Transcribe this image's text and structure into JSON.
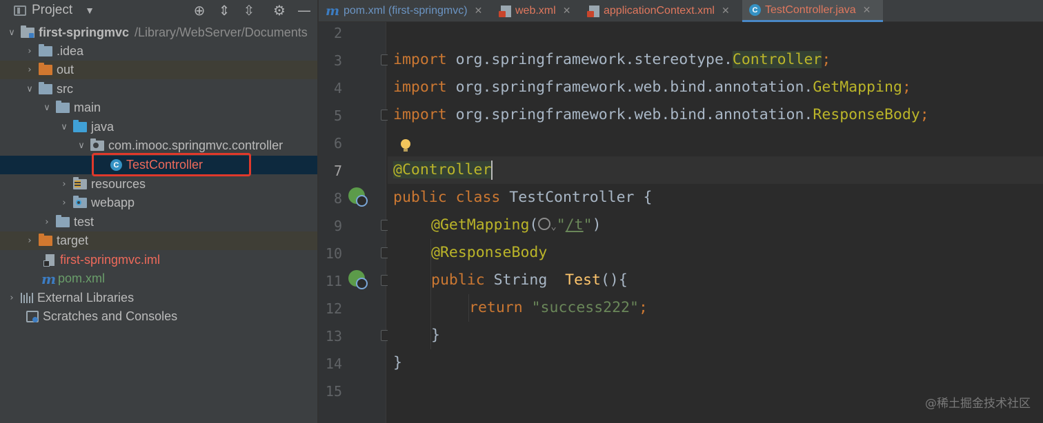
{
  "project_panel": {
    "title": "Project",
    "toolbar_icons": [
      "locate-icon",
      "expand-all-icon",
      "collapse-all-icon",
      "gear-icon",
      "minimize-icon"
    ],
    "tree": [
      {
        "label": "first-springmvc",
        "path": "/Library/WebServer/Documents",
        "depth": 0,
        "expanded": true,
        "icon": "module-folder-icon"
      },
      {
        "label": ".idea",
        "depth": 1,
        "expanded": false,
        "icon": "folder-icon"
      },
      {
        "label": "out",
        "depth": 1,
        "expanded": false,
        "icon": "excluded-folder-icon"
      },
      {
        "label": "src",
        "depth": 1,
        "expanded": true,
        "icon": "folder-icon"
      },
      {
        "label": "main",
        "depth": 2,
        "expanded": true,
        "icon": "folder-icon"
      },
      {
        "label": "java",
        "depth": 3,
        "expanded": true,
        "icon": "source-folder-icon"
      },
      {
        "label": "com.imooc.springmvc.controller",
        "depth": 4,
        "expanded": true,
        "icon": "package-icon"
      },
      {
        "label": "TestController",
        "depth": 5,
        "icon": "java-class-icon",
        "selected": true
      },
      {
        "label": "resources",
        "depth": 3,
        "expanded": false,
        "icon": "resources-folder-icon"
      },
      {
        "label": "webapp",
        "depth": 3,
        "expanded": false,
        "icon": "web-folder-icon"
      },
      {
        "label": "test",
        "depth": 2,
        "expanded": false,
        "icon": "folder-icon"
      },
      {
        "label": "target",
        "depth": 1,
        "expanded": false,
        "icon": "excluded-folder-icon"
      },
      {
        "label": "first-springmvc.iml",
        "depth": 1,
        "icon": "iml-file-icon"
      },
      {
        "label": "pom.xml",
        "depth": 1,
        "icon": "maven-icon"
      },
      {
        "label": "External Libraries",
        "depth": 0,
        "expanded": false,
        "icon": "libraries-icon"
      },
      {
        "label": "Scratches and Consoles",
        "depth": 0,
        "icon": "scratches-icon"
      }
    ]
  },
  "tabs": [
    {
      "label": "pom.xml (first-springmvc)",
      "icon": "maven-icon"
    },
    {
      "label": "web.xml",
      "icon": "xml-file-icon"
    },
    {
      "label": "applicationContext.xml",
      "icon": "xml-file-icon"
    },
    {
      "label": "TestController.java",
      "icon": "java-class-icon",
      "active": true
    }
  ],
  "editor": {
    "line_numbers": [
      "2",
      "3",
      "4",
      "5",
      "6",
      "7",
      "8",
      "9",
      "10",
      "11",
      "12",
      "13",
      "14",
      "15"
    ],
    "current_line": "7",
    "code": {
      "l3_kw": "import",
      "l3_pkg": " org.springframework.stereotype.",
      "l3_cls": "Controller",
      "l3_end": ";",
      "l4_kw": "import",
      "l4_pkg": " org.springframework.web.bind.annotation.",
      "l4_cls": "GetMapping",
      "l4_end": ";",
      "l5_kw": "import",
      "l5_pkg": " org.springframework.web.bind.annotation.",
      "l5_cls": "ResponseBody",
      "l5_end": ";",
      "l7_ann": "@Controller",
      "l8_kw": "public class",
      "l8_rest": " TestController {",
      "l9_ann": "@GetMapping",
      "l9_open": "(",
      "l9_quote1": "\"",
      "l9_url": "/t",
      "l9_quote2": "\"",
      "l9_close": ")",
      "l10_ann": "@ResponseBody",
      "l11_kw": "public",
      "l11_type": " String  ",
      "l11_method": "Test",
      "l11_rest": "(){",
      "l12_kw": "return",
      "l12_str": " \"success222\"",
      "l12_end": ";",
      "l13": "}",
      "l14": "}"
    }
  },
  "watermark": "@稀土掘金技术社区",
  "colors": {
    "keyword": "#cc7832",
    "annotation": "#bbb529",
    "string": "#6a8759",
    "method": "#ffc66d",
    "highlight_border": "#e0392b"
  }
}
